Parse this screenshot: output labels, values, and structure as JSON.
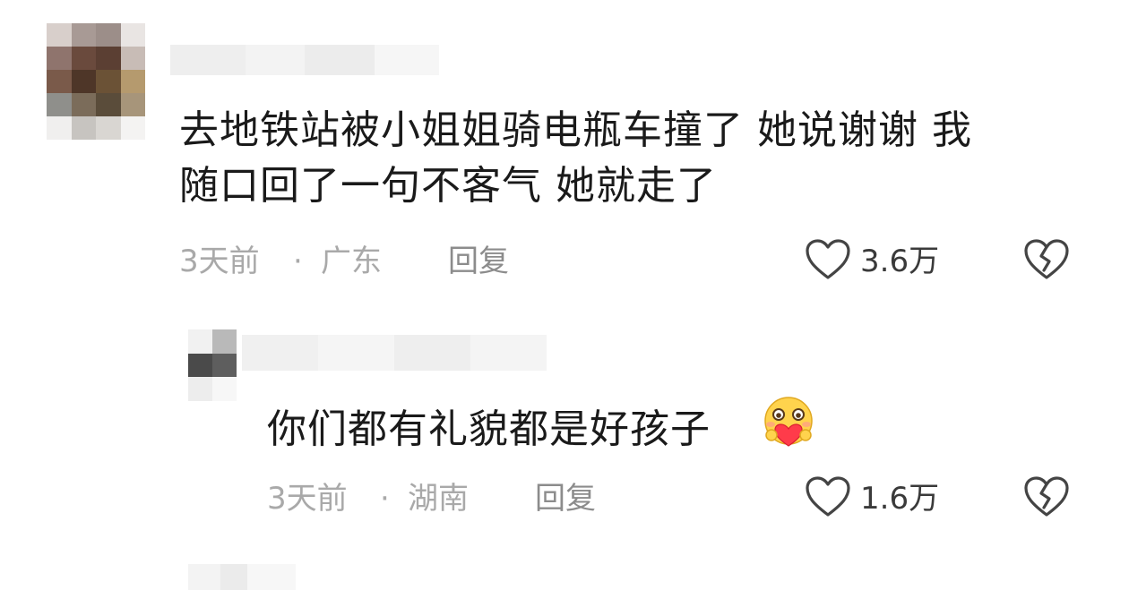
{
  "comments": [
    {
      "text_line1": "去地铁站被小姐姐骑电瓶车撞了  她说谢谢 我",
      "text_line2": "随口回了一句不客气  她就走了",
      "time": "3天前",
      "separator": "·",
      "location": "广东",
      "reply_label": "回复",
      "likes": "3.6万"
    },
    {
      "text": "你们都有礼貌都是好孩子",
      "emoji_icon": "heart-hug-emoji-icon",
      "time": "3天前",
      "separator": "·",
      "location": "湖南",
      "reply_label": "回复",
      "likes": "1.6万"
    }
  ],
  "colors": {
    "text": "#1a1a1a",
    "meta": "#a9a9a9",
    "reply": "#8c8c8c",
    "icon": "#444444"
  }
}
